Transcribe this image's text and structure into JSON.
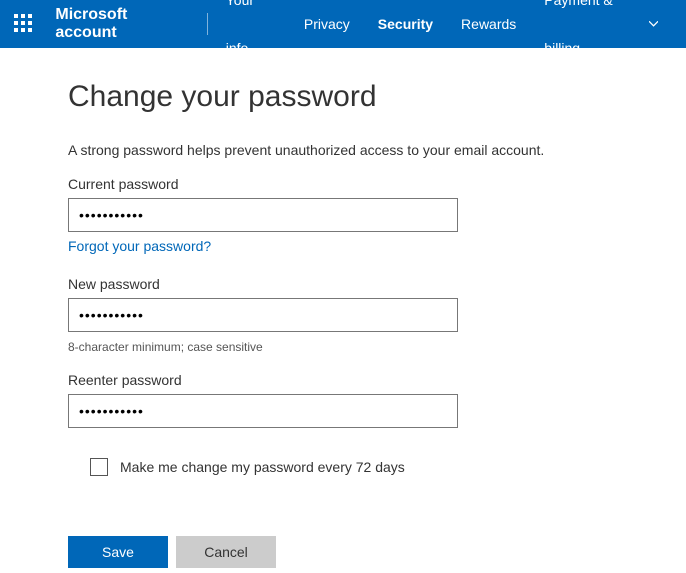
{
  "nav": {
    "brand": "Microsoft account",
    "items": [
      {
        "label": "Your info",
        "active": false
      },
      {
        "label": "Privacy",
        "active": false
      },
      {
        "label": "Security",
        "active": true
      },
      {
        "label": "Rewards",
        "active": false
      },
      {
        "label": "Payment & billing",
        "active": false,
        "dropdown": true
      }
    ]
  },
  "page": {
    "title": "Change your password",
    "subtitle": "A strong password helps prevent unauthorized access to your email account.",
    "current_label": "Current password",
    "current_value": "•••••••••••",
    "forgot_link": "Forgot your password?",
    "new_label": "New password",
    "new_value": "•••••••••••",
    "hint": "8-character minimum; case sensitive",
    "reenter_label": "Reenter password",
    "reenter_value": "•••••••••••",
    "checkbox_label": "Make me change my password every 72 days",
    "save_label": "Save",
    "cancel_label": "Cancel"
  }
}
